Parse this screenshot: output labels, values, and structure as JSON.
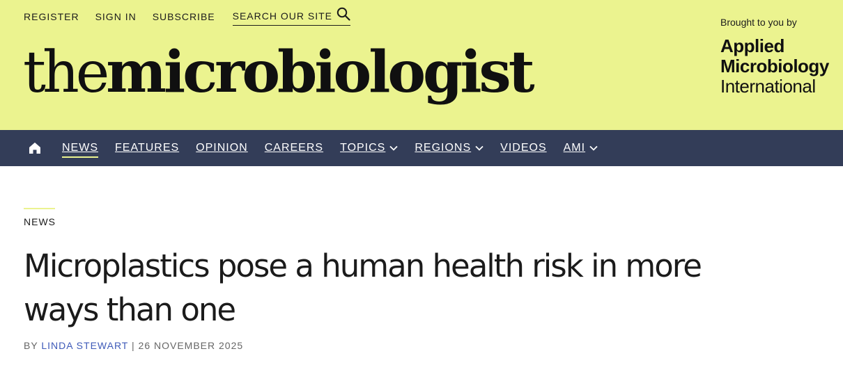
{
  "utility": {
    "register": "REGISTER",
    "sign_in": "SIGN IN",
    "subscribe": "SUBSCRIBE",
    "search_label": "SEARCH OUR SITE"
  },
  "logo": {
    "thin": "the",
    "bold": "microbiologist"
  },
  "sponsor": {
    "brought": "Brought to you by",
    "line1": "Applied",
    "line2": "Microbiology",
    "line3": "International"
  },
  "nav": {
    "items": [
      {
        "label": "NEWS",
        "active": true,
        "dropdown": false
      },
      {
        "label": "FEATURES",
        "dropdown": false
      },
      {
        "label": "OPINION",
        "dropdown": false
      },
      {
        "label": "CAREERS",
        "dropdown": false
      },
      {
        "label": "TOPICS",
        "dropdown": true
      },
      {
        "label": "REGIONS",
        "dropdown": true
      },
      {
        "label": "VIDEOS",
        "dropdown": false
      },
      {
        "label": "AMI",
        "dropdown": true
      }
    ]
  },
  "article": {
    "section": "NEWS",
    "headline": "Microplastics pose a human health risk in more ways than one",
    "byline_prefix": "BY",
    "author": "LINDA STEWART",
    "separator": "|",
    "date": "26 NOVEMBER 2025"
  },
  "colors": {
    "masthead_bg": "#ebf38f",
    "nav_bg": "#333d58",
    "author_link": "#3e5ab8"
  }
}
